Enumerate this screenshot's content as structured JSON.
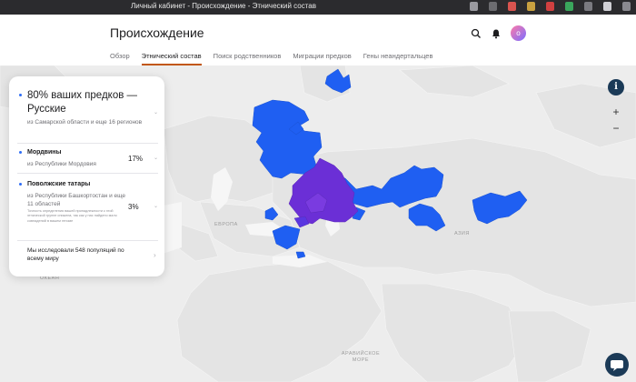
{
  "window": {
    "title": "Личный кабинет - Происхождение - Этнический состав"
  },
  "header": {
    "title": "Происхождение",
    "avatar_initial": "о",
    "tabs": [
      {
        "label": "Обзор",
        "active": false
      },
      {
        "label": "Этнический состав",
        "active": true
      },
      {
        "label": "Поиск родственников",
        "active": false
      },
      {
        "label": "Миграции предков",
        "active": false
      },
      {
        "label": "Гены неандертальцев",
        "active": false
      }
    ]
  },
  "panel": {
    "main": {
      "title": "80% ваших предков — Русские",
      "subtitle": "из Самарской области и еще 16 регионов"
    },
    "items": [
      {
        "title": "Мордвины",
        "subtitle": "из Республики Мордовия",
        "percent": "17%"
      },
      {
        "title": "Поволжские татары",
        "subtitle": "из Республики Башкортостан и еще 11 областей",
        "percent": "3%",
        "note": "Точность определения вашей принадлежности к этой этнической группе снижена, так как у нас найдено мало совпадений в вашем геноме"
      }
    ],
    "footer": "Мы исследовали 548 популяций по всему миру"
  },
  "map": {
    "labels": [
      "ЕВРОПА",
      "АЗИЯ",
      "ОКЕАН",
      "АРАВИЙСКОЕ МОРЕ"
    ],
    "colors": {
      "russians": "#1f5ff2",
      "mordvins": "#6b2fd6",
      "tatars": "#5a36e0",
      "land": "#e6e6e6",
      "water": "#ffffff"
    }
  },
  "controls": {
    "info": "i",
    "zoom_in": "+",
    "zoom_out": "−"
  },
  "icons": [
    "search-icon",
    "bell-icon",
    "info-icon",
    "chat-icon",
    "chevron-down-icon",
    "chevron-right-icon"
  ]
}
